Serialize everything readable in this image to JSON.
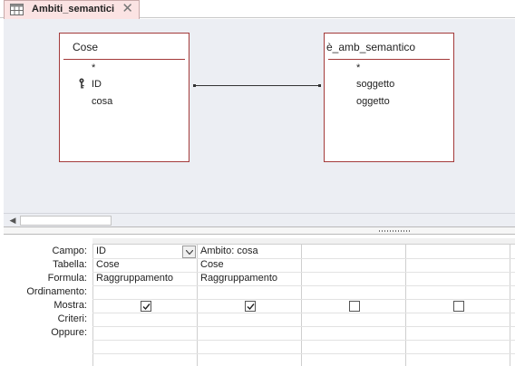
{
  "tab": {
    "title": "Ambiti_semantici",
    "close_glyph": "✕",
    "icon": "query-icon"
  },
  "tables": [
    {
      "title": "Cose",
      "fields": [
        "*",
        "ID",
        "cosa"
      ],
      "key_field": "ID"
    },
    {
      "title": "è_amb_semantico",
      "fields": [
        "*",
        "soggetto",
        "oggetto"
      ]
    }
  ],
  "scrollbar": {
    "left_arrow": "◀"
  },
  "grid": {
    "row_labels": [
      "Campo:",
      "Tabella:",
      "Formula:",
      "Ordinamento:",
      "Mostra:",
      "Criteri:",
      "Oppure:"
    ],
    "columns": [
      {
        "campo": "ID",
        "tabella": "Cose",
        "formula": "Raggruppamento",
        "mostra": true
      },
      {
        "campo": "Ambito: cosa",
        "tabella": "Cose",
        "formula": "Raggruppamento",
        "mostra": true
      },
      {
        "campo": "",
        "tabella": "",
        "formula": "",
        "mostra": false
      },
      {
        "campo": "",
        "tabella": "",
        "formula": "",
        "mostra": false
      }
    ]
  },
  "colors": {
    "table_border": "#a33a3a",
    "design_bg": "#eceef3",
    "tab_bg": "#fbe3e3"
  }
}
